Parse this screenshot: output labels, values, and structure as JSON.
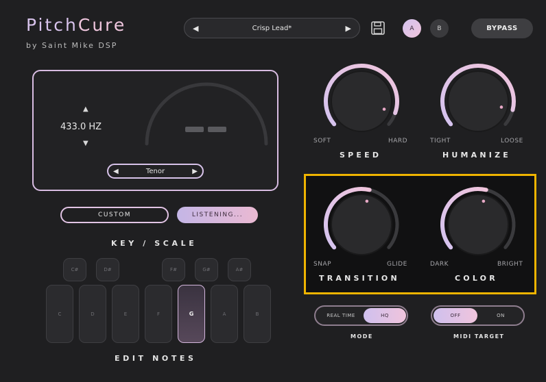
{
  "app": {
    "name_part1": "Pitch",
    "name_part2": "Cure",
    "subtitle": "by Saint Mike DSP"
  },
  "header": {
    "preset_name": "Crisp Lead*",
    "prev_arrow": "◀",
    "next_arrow": "▶",
    "save_icon": "floppy-disk-icon",
    "ab_a": "A",
    "ab_b": "B",
    "bypass": "BYPASS"
  },
  "tuner": {
    "frequency": "433.0 HZ",
    "up_arrow": "▲",
    "down_arrow": "▼",
    "note_display": "– –",
    "voice": "Tenor",
    "voice_prev": "◀",
    "voice_next": "▶"
  },
  "buttons": {
    "custom": "CUSTOM",
    "listening": "LISTENING..."
  },
  "key_scale": {
    "title": "KEY / SCALE",
    "sharps": [
      "C#",
      "D#",
      "F#",
      "G#",
      "A#"
    ],
    "naturals": [
      "C",
      "D",
      "E",
      "F",
      "G",
      "A",
      "B"
    ],
    "active_note": "G",
    "edit_notes": "EDIT NOTES"
  },
  "knobs": [
    {
      "title": "SPEED",
      "min_label": "SOFT",
      "max_label": "HARD",
      "value": 0.92
    },
    {
      "title": "HUMANIZE",
      "min_label": "TIGHT",
      "max_label": "LOOSE",
      "value": 0.9
    },
    {
      "title": "TRANSITION",
      "min_label": "SNAP",
      "max_label": "GLIDE",
      "value": 0.55
    },
    {
      "title": "COLOR",
      "min_label": "DARK",
      "max_label": "BRIGHT",
      "value": 0.55
    }
  ],
  "mode": {
    "title": "MODE",
    "options": [
      "REAL TIME",
      "HQ"
    ],
    "selected": "HQ"
  },
  "midi_target": {
    "title": "MIDI TARGET",
    "options": [
      "OFF",
      "ON"
    ],
    "selected": "OFF"
  },
  "colors": {
    "accent_lilac": "#d4c3ef",
    "accent_pink": "#f0c4dc",
    "highlight": "#f0b400",
    "background": "#1f1f21"
  }
}
